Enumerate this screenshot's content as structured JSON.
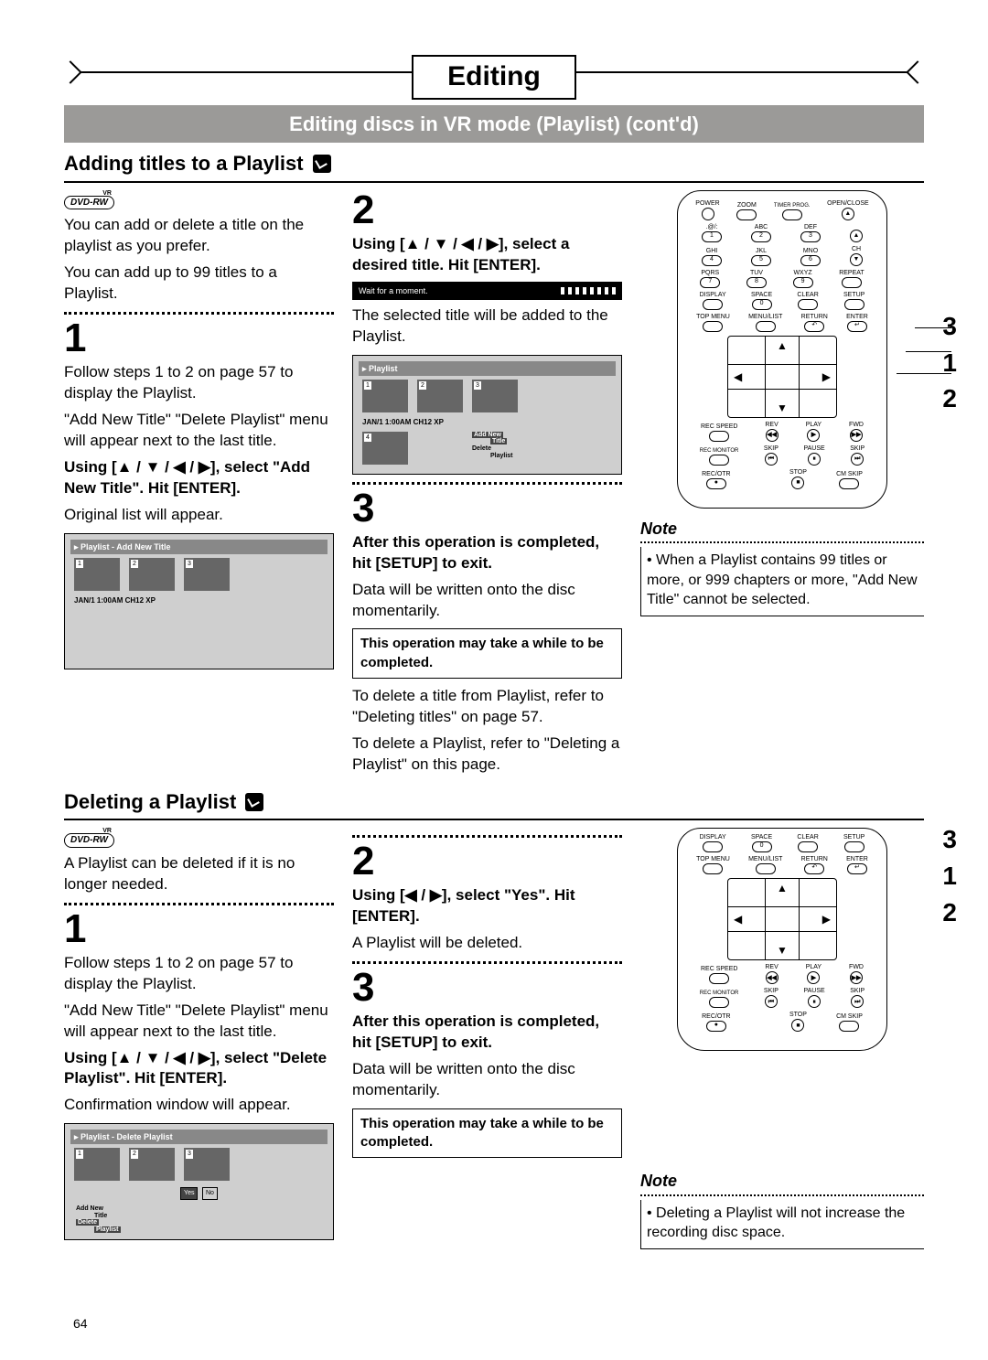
{
  "header": {
    "title": "Editing",
    "subtitle": "Editing discs in VR mode (Playlist) (cont'd)"
  },
  "page_number": "64",
  "section1": {
    "title": "Adding titles to a Playlist",
    "disc_badge": "DVD-RW",
    "intro1": "You can add or delete a title on the playlist as you prefer.",
    "intro2": "You can add up to 99 titles to a Playlist.",
    "step1": {
      "num": "1",
      "p1": "Follow steps 1 to 2 on page 57 to display the Playlist.",
      "p2": "\"Add New Title\" \"Delete Playlist\" menu will appear next to the last title.",
      "instr": "Using [▲ / ▼ / ◀ / ▶], select \"Add New Title\". Hit [ENTER].",
      "p3": "Original list will appear.",
      "screen": {
        "title": "Playlist - Add New Title",
        "thumbs": [
          "1",
          "2",
          "3"
        ],
        "info": "JAN/1 1:00AM CH12 XP"
      }
    },
    "step2": {
      "num": "2",
      "instr": "Using [▲ / ▼ / ◀ / ▶], select a desired title. Hit [ENTER].",
      "wait": "Wait for a moment.",
      "p1": "The selected title will be added to the Playlist.",
      "screen": {
        "title": "Playlist",
        "thumbs": [
          "1",
          "2",
          "3",
          "4"
        ],
        "info": "JAN/1 1:00AM CH12 XP",
        "menu1a": "Add New",
        "menu1b": "Title",
        "menu2a": "Delete",
        "menu2b": "Playlist"
      }
    },
    "step3": {
      "num": "3",
      "instr": "After this operation is completed, hit [SETUP] to exit.",
      "p1": "Data will be written onto the disc momentarily.",
      "warn": "This operation may take a while to be completed.",
      "p2": "To delete a title from Playlist, refer to \"Deleting titles\" on page 57.",
      "p3": "To delete a Playlist, refer to \"Deleting a Playlist\" on this page."
    },
    "note": {
      "heading": "Note",
      "body": "• When a Playlist contains 99 titles or more, or 999 chapters or more, \"Add New Title\" cannot be selected."
    },
    "callouts": [
      "3",
      "1",
      "2"
    ]
  },
  "section2": {
    "title": "Deleting a Playlist",
    "disc_badge": "DVD-RW",
    "intro": "A Playlist can be deleted if it is no longer needed.",
    "step1": {
      "num": "1",
      "p1": "Follow steps 1 to 2 on page 57 to display the Playlist.",
      "p2": "\"Add New Title\" \"Delete Playlist\" menu will appear next to the last title.",
      "instr": "Using [▲ / ▼ / ◀ / ▶], select \"Delete Playlist\". Hit [ENTER].",
      "p3": "Confirmation window will appear.",
      "screen": {
        "title": "Playlist - Delete Playlist",
        "thumbs": [
          "1",
          "2",
          "3"
        ],
        "yes": "Yes",
        "no": "No",
        "menu1a": "Add New",
        "menu1b": "Title",
        "menu2a": "Delete",
        "menu2b": "Playlist"
      }
    },
    "step2": {
      "num": "2",
      "instr": "Using [◀ / ▶], select \"Yes\". Hit [ENTER].",
      "p1": "A Playlist will be deleted."
    },
    "step3": {
      "num": "3",
      "instr": "After this operation is completed, hit [SETUP] to exit.",
      "p1": "Data will be written onto the disc momentarily.",
      "warn": "This operation may take a while to be completed."
    },
    "note": {
      "heading": "Note",
      "body": "• Deleting a Playlist will not increase the recording disc space."
    },
    "callouts": [
      "3",
      "1",
      "2"
    ]
  },
  "remote": {
    "row0": [
      "POWER",
      "",
      "",
      "OPEN/CLOSE"
    ],
    "row0b": [
      "",
      "ZOOM",
      "TIMER PROG.",
      ""
    ],
    "row1": [
      ".@/:",
      "ABC",
      "DEF",
      ""
    ],
    "row1n": [
      "1",
      "2",
      "3"
    ],
    "row2": [
      "GHI",
      "JKL",
      "MNO",
      "CH"
    ],
    "row2n": [
      "4",
      "5",
      "6"
    ],
    "row3": [
      "PQRS",
      "TUV",
      "WXYZ",
      "REPEAT"
    ],
    "row3n": [
      "7",
      "8",
      "9"
    ],
    "row4": [
      "DISPLAY",
      "SPACE",
      "CLEAR",
      "SETUP"
    ],
    "row4n": [
      "",
      "0",
      "",
      ""
    ],
    "row5": [
      "TOP MENU",
      "MENU/LIST",
      "RETURN",
      "ENTER"
    ],
    "row6": [
      "REC SPEED",
      "REV",
      "PLAY",
      "FWD"
    ],
    "row7": [
      "REC MONITOR",
      "SKIP",
      "PAUSE",
      "SKIP"
    ],
    "row8": [
      "REC/OTR",
      "",
      "STOP",
      "CM SKIP"
    ]
  }
}
